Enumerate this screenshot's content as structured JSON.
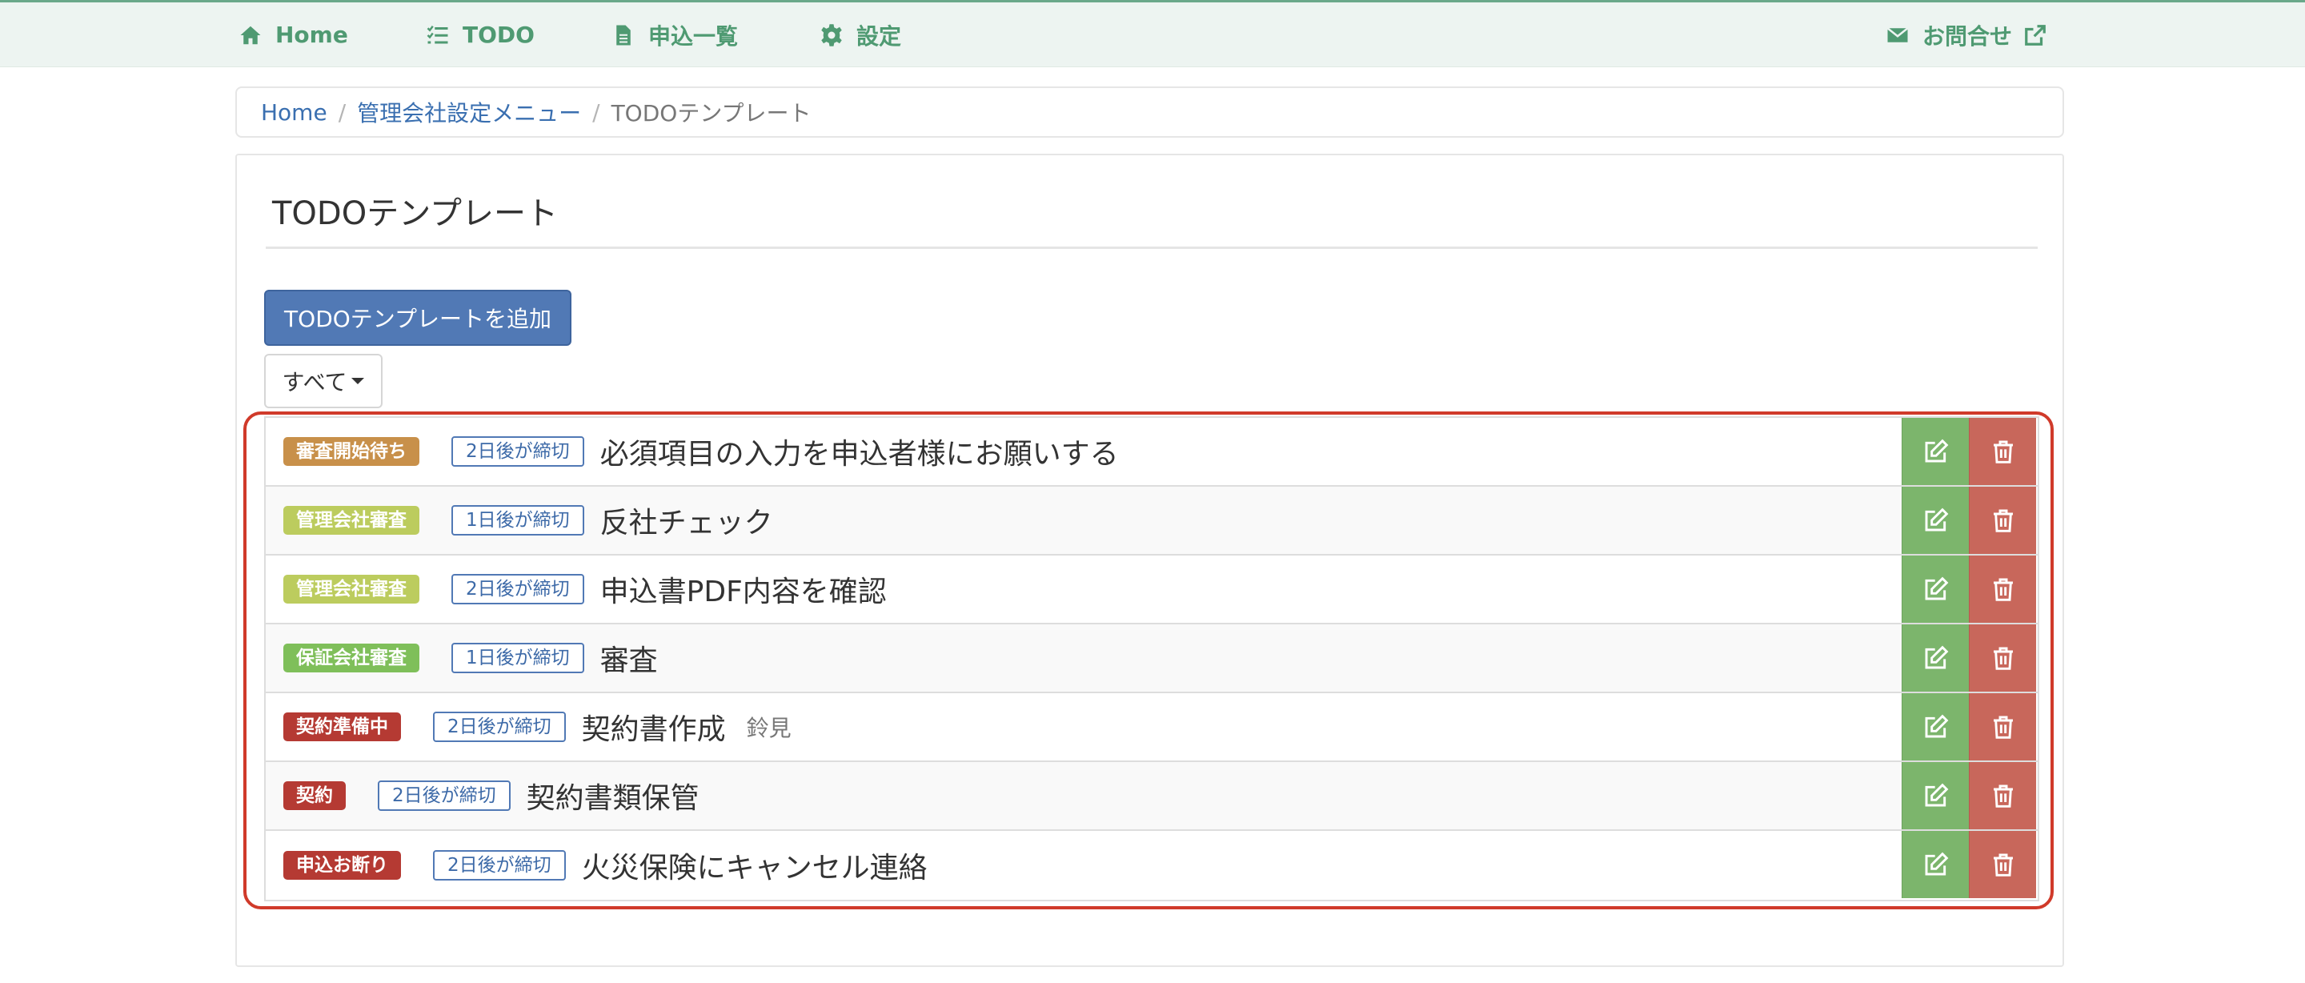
{
  "nav": {
    "home_label": "Home",
    "todo_label": "TODO",
    "applications_label": "申込一覧",
    "settings_label": "設定",
    "contact_label": "お問合せ",
    "icons": [
      "home-icon",
      "checklist-icon",
      "document-icon",
      "gear-icon",
      "envelope-icon",
      "external-link-icon"
    ]
  },
  "breadcrumb": {
    "items": [
      "Home",
      "管理会社設定メニュー"
    ],
    "current": "TODOテンプレート"
  },
  "page": {
    "title": "TODOテンプレート",
    "add_button_label": "TODOテンプレートを追加",
    "filter_label": "すべて"
  },
  "todos": [
    {
      "status": "審査開始待ち",
      "status_color": "#c8904a",
      "deadline": "2日後が締切",
      "title": "必須項目の入力を申込者様にお願いする",
      "assignee": ""
    },
    {
      "status": "管理会社審査",
      "status_color": "#bccc5e",
      "deadline": "1日後が締切",
      "title": "反社チェック",
      "assignee": ""
    },
    {
      "status": "管理会社審査",
      "status_color": "#bccc5e",
      "deadline": "2日後が締切",
      "title": "申込書PDF内容を確認",
      "assignee": ""
    },
    {
      "status": "保証会社審査",
      "status_color": "#7fbf5a",
      "deadline": "1日後が締切",
      "title": "審査",
      "assignee": ""
    },
    {
      "status": "契約準備中",
      "status_color": "#b53a33",
      "deadline": "2日後が締切",
      "title": "契約書作成",
      "assignee": "鈴見"
    },
    {
      "status": "契約",
      "status_color": "#b53a33",
      "deadline": "2日後が締切",
      "title": "契約書類保管",
      "assignee": ""
    },
    {
      "status": "申込お断り",
      "status_color": "#b53a33",
      "deadline": "2日後が締切",
      "title": "火災保険にキャンセル連絡",
      "assignee": ""
    }
  ],
  "colors": {
    "nav_accent": "#4f9a72",
    "primary": "#5179b5",
    "edit": "#7cb56c",
    "delete": "#c8675b",
    "highlight": "#d03a2a"
  }
}
